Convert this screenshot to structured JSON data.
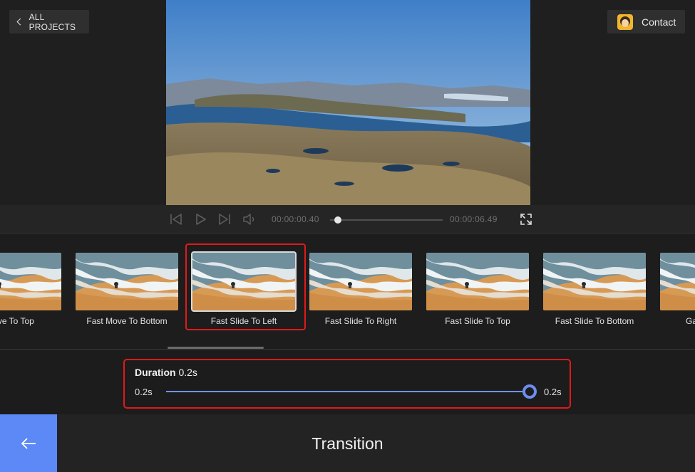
{
  "header": {
    "back_label": "ALL PROJECTS",
    "contact_label": "Contact"
  },
  "player": {
    "current_time": "00:00:00.40",
    "total_time": "00:00:06.49",
    "progress": 0.062
  },
  "transitions": [
    {
      "label": "Move To Top",
      "selected": false
    },
    {
      "label": "Fast Move To Bottom",
      "selected": false
    },
    {
      "label": "Fast Slide To Left",
      "selected": true
    },
    {
      "label": "Fast Slide To Right",
      "selected": false
    },
    {
      "label": "Fast Slide To Top",
      "selected": false
    },
    {
      "label": "Fast Slide To Bottom",
      "selected": false
    },
    {
      "label": "Ga",
      "selected": false
    }
  ],
  "duration": {
    "label": "Duration",
    "value": "0.2s",
    "min_label": "0.2s",
    "max_label": "0.2s",
    "level": 1.0
  },
  "footer": {
    "title": "Transition"
  },
  "colors": {
    "accent": "#5c89f5",
    "highlight": "#e01a1a"
  }
}
